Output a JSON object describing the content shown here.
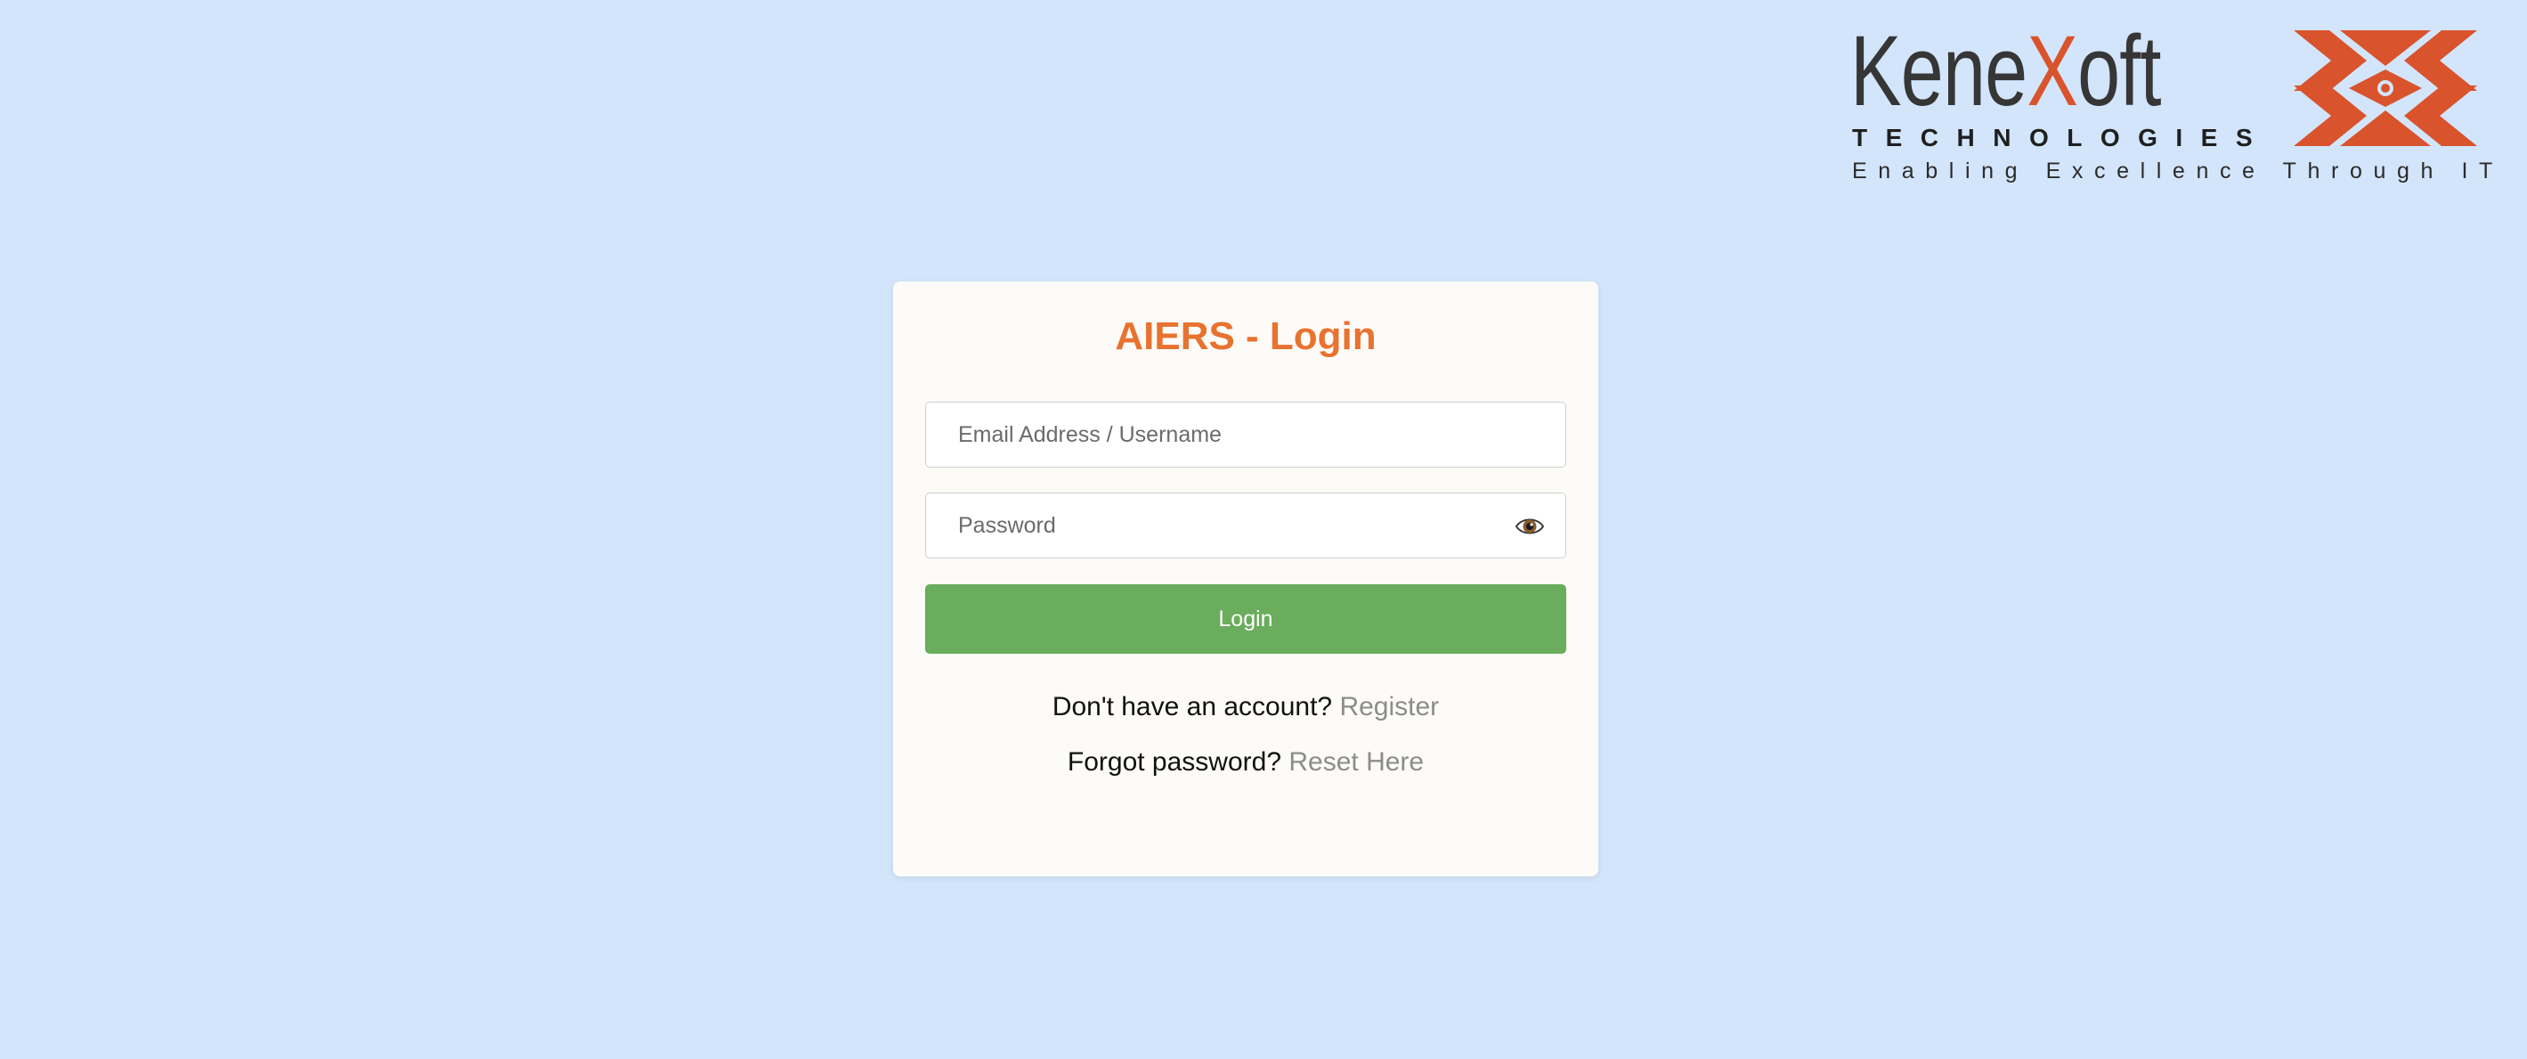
{
  "brand": {
    "wordmark_prefix": "Kene",
    "wordmark_x": "X",
    "wordmark_suffix": "oft",
    "subtitle": "TECHNOLOGIES",
    "tagline": "Enabling Excellence Through IT",
    "accent_color": "#d9532c",
    "text_color": "#363636",
    "mark_icon": "kenexoft-chevron-x-logo"
  },
  "login": {
    "title": "AIERS - Login",
    "title_color": "#e8722f",
    "email_placeholder": "Email Address / Username",
    "email_value": "",
    "password_placeholder": "Password",
    "password_value": "",
    "password_toggle_icon": "eye-icon",
    "button_label": "Login",
    "button_color": "#6aad5c",
    "register_prompt": "Don't have an account?",
    "register_link": "Register",
    "reset_prompt": "Forgot password?",
    "reset_link": "Reset Here"
  },
  "theme": {
    "background": "#d3e5fb",
    "card_background": "#fdfbf7",
    "link_color": "#8c8c8c"
  }
}
